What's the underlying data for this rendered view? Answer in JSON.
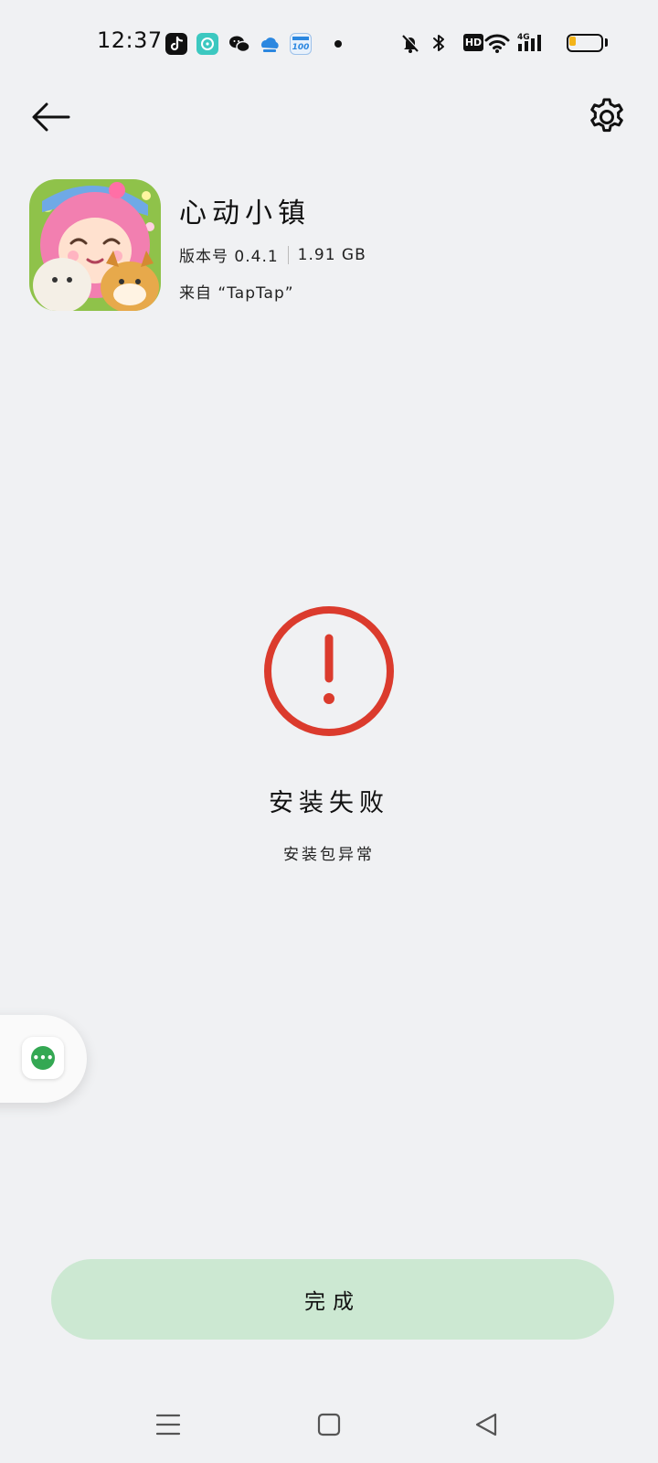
{
  "status_bar": {
    "time": "12:37",
    "notification_icons": [
      "tiktok-icon",
      "chat-bubble-icon",
      "wechat-icon",
      "cloud-icon",
      "score-100-icon"
    ],
    "hd_label": "HD",
    "network_label": "4G",
    "battery_level": 0.22,
    "battery_color": "#f3b419"
  },
  "header": {
    "back_icon": "arrow-left-icon",
    "settings_icon": "gear-icon"
  },
  "app": {
    "name": "心动小镇",
    "version_label": "版本号 0.4.1",
    "size": "1.91 GB",
    "source": "来自 “TapTap”"
  },
  "result": {
    "icon": "exclamation-circle-icon",
    "icon_color": "#db3b2d",
    "title": "安装失败",
    "reason": "安装包异常"
  },
  "floating_bubble": {
    "icon": "more-dots-icon",
    "dots": "•••",
    "color": "#34a853"
  },
  "done_button": {
    "label": "完成",
    "background": "#cce8d2"
  },
  "nav_bar": {
    "items": [
      "menu-icon",
      "home-square-icon",
      "back-triangle-icon"
    ]
  }
}
